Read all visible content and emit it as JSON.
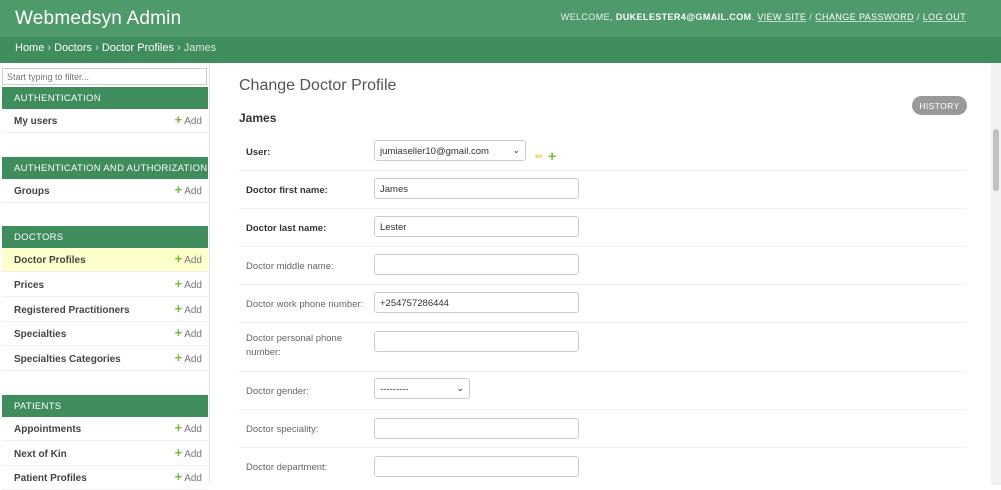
{
  "header": {
    "site_name": "Webmedsyn Admin",
    "welcome": "WELCOME,",
    "username": "DUKELESTER4@GMAIL.COM",
    "view_site": "VIEW SITE",
    "change_password": "CHANGE PASSWORD",
    "log_out": "LOG OUT",
    "separator": " / "
  },
  "breadcrumbs": {
    "home": "Home",
    "doctors": "Doctors",
    "doctor_profiles": "Doctor Profiles",
    "current": "James",
    "sep": " › "
  },
  "sidebar": {
    "filter_placeholder": "Start typing to filter...",
    "add_label": "Add",
    "modules": [
      {
        "caption": "AUTHENTICATION",
        "items": [
          {
            "label": "My users"
          }
        ]
      },
      {
        "caption": "AUTHENTICATION AND AUTHORIZATION",
        "items": [
          {
            "label": "Groups"
          }
        ]
      },
      {
        "caption": "DOCTORS",
        "items": [
          {
            "label": "Doctor Profiles",
            "current": true
          },
          {
            "label": "Prices"
          },
          {
            "label": "Registered Practitioners"
          },
          {
            "label": "Specialties"
          },
          {
            "label": "Specialties Categories"
          }
        ]
      },
      {
        "caption": "PATIENTS",
        "items": [
          {
            "label": "Appointments"
          },
          {
            "label": "Next of Kin"
          },
          {
            "label": "Patient Profiles"
          }
        ]
      }
    ]
  },
  "main": {
    "title": "Change Doctor Profile",
    "history_button": "HISTORY",
    "object_name": "James",
    "fields": {
      "user": {
        "label": "User:",
        "value": "jumiaseller10@gmail.com"
      },
      "first_name": {
        "label": "Doctor first name:",
        "value": "James"
      },
      "last_name": {
        "label": "Doctor last name:",
        "value": "Lester"
      },
      "middle_name": {
        "label": "Doctor middle name:",
        "value": ""
      },
      "work_phone": {
        "label": "Doctor work phone number:",
        "value": "+254757286444"
      },
      "personal_phone": {
        "label": "Doctor personal phone number:",
        "value": ""
      },
      "gender": {
        "label": "Doctor gender:",
        "value": "---------"
      },
      "speciality": {
        "label": "Doctor speciality:",
        "value": ""
      },
      "department": {
        "label": "Doctor department:",
        "value": ""
      }
    }
  },
  "colors": {
    "header_bg": "#4e9a6b",
    "breadcrumb_bg": "#3f8c5c",
    "module_caption_bg": "#3f8c5c",
    "current_row_bg": "#ffffcc",
    "add_icon": "#70bf2b",
    "history_button_bg": "#999999"
  },
  "icons": {
    "edit": "pencil-icon",
    "add": "plus-icon",
    "dropdown": "chevron-down-icon"
  }
}
